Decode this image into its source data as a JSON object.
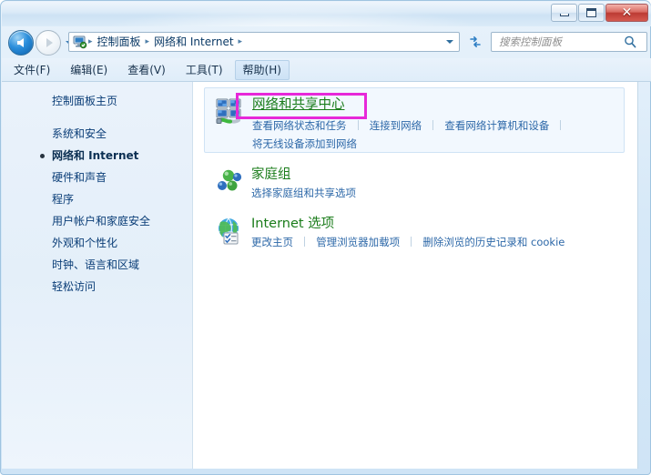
{
  "window": {
    "title": "",
    "controls": {
      "minimize": "minimize",
      "maximize": "maximize",
      "close": "✕"
    }
  },
  "addressbar": {
    "back_tooltip": "后退",
    "forward_tooltip": "前进",
    "history_dropdown": "▼",
    "icon": "control-panel-icon",
    "breadcrumbs": [
      {
        "label": "控制面板"
      },
      {
        "label": "网络和 Internet"
      }
    ],
    "separator": "▸",
    "dropdown": "▼",
    "refresh_icon": "refresh-icon"
  },
  "search": {
    "placeholder": "搜索控制面板",
    "value": "",
    "icon": "search-icon"
  },
  "menubar": {
    "items": [
      {
        "label": "文件(F)",
        "hover": false
      },
      {
        "label": "编辑(E)",
        "hover": false
      },
      {
        "label": "查看(V)",
        "hover": false
      },
      {
        "label": "工具(T)",
        "hover": false
      },
      {
        "label": "帮助(H)",
        "hover": true
      }
    ]
  },
  "sidebar": {
    "home_label": "控制面板主页",
    "items": [
      {
        "label": "系统和安全",
        "current": false
      },
      {
        "label": "网络和 Internet",
        "current": true
      },
      {
        "label": "硬件和声音",
        "current": false
      },
      {
        "label": "程序",
        "current": false
      },
      {
        "label": "用户帐户和家庭安全",
        "current": false
      },
      {
        "label": "外观和个性化",
        "current": false
      },
      {
        "label": "时钟、语言和区域",
        "current": false
      },
      {
        "label": "轻松访问",
        "current": false
      }
    ]
  },
  "content": {
    "categories": [
      {
        "icon": "network-sharing-center-icon",
        "title": "网络和共享中心",
        "hovered": true,
        "links_row1": [
          "查看网络状态和任务",
          "连接到网络",
          "查看网络计算机和设备"
        ],
        "links_row2": [
          "将无线设备添加到网络"
        ]
      },
      {
        "icon": "homegroup-icon",
        "title": "家庭组",
        "hovered": false,
        "links_row1": [
          "选择家庭组和共享选项"
        ],
        "links_row2": []
      },
      {
        "icon": "internet-options-icon",
        "title": "Internet 选项",
        "hovered": false,
        "links_row1": [
          "更改主页",
          "管理浏览器加载项",
          "删除浏览的历史记录和 cookie"
        ],
        "links_row2": []
      }
    ]
  },
  "annotation": {
    "target": "网络和共享中心",
    "color": "#e728d9"
  },
  "colors": {
    "link": "#2d68a8",
    "category_title": "#1a7c1a",
    "sidebar_text": "#0a3d77",
    "highlight": "#e728d9",
    "close_button": "#bc3b34"
  }
}
